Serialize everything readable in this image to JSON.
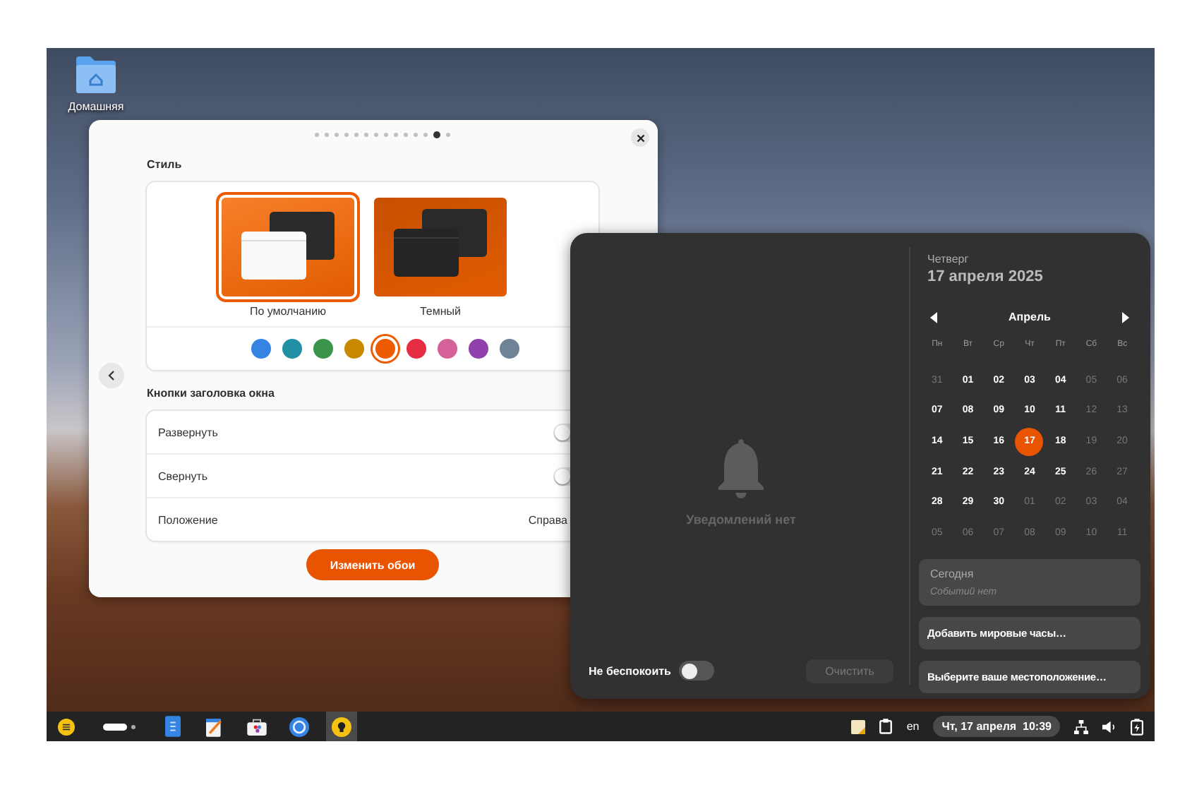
{
  "desktop_icons": [
    {
      "label": "Домашняя"
    }
  ],
  "settings_dialog": {
    "page_dots": [
      {
        "selected": false
      },
      {
        "selected": false
      },
      {
        "selected": false
      },
      {
        "selected": false
      },
      {
        "selected": false
      },
      {
        "selected": false
      },
      {
        "selected": false
      },
      {
        "selected": false
      },
      {
        "selected": false
      },
      {
        "selected": false
      },
      {
        "selected": false
      },
      {
        "selected": false
      },
      {
        "selected": true
      },
      {
        "selected": false
      }
    ],
    "style_section": {
      "title": "Стиль",
      "themes": [
        {
          "kind": "light",
          "label": "По умолчанию",
          "selected": true
        },
        {
          "kind": "dark",
          "label": "Темный",
          "selected": false
        }
      ],
      "accent_colors": [
        {
          "color": "#3584e4",
          "selected": false
        },
        {
          "color": "#2190a4",
          "selected": false
        },
        {
          "color": "#3a944a",
          "selected": false
        },
        {
          "color": "#c88800",
          "selected": false
        },
        {
          "color": "#ed5b00",
          "selected": true
        },
        {
          "color": "#e62d42",
          "selected": false
        },
        {
          "color": "#d56199",
          "selected": false
        },
        {
          "color": "#9141ac",
          "selected": false
        },
        {
          "color": "#6f8396",
          "selected": false
        }
      ]
    },
    "title_buttons_section": {
      "title": "Кнопки заголовка окна",
      "rows": [
        {
          "kind": "toggle",
          "label": "Развернуть",
          "on": false
        },
        {
          "kind": "toggle",
          "label": "Свернуть",
          "on": false
        },
        {
          "kind": "value",
          "label": "Положение",
          "value": "Справа"
        }
      ]
    },
    "primary_button": "Изменить обои"
  },
  "notifications": {
    "empty_text": "Уведомлений нет",
    "dnd_label": "Не беспокоить",
    "dnd_on": false,
    "clear_button": {
      "label": "Очистить",
      "disabled": true
    }
  },
  "calendar": {
    "weekday": "Четверг",
    "date": "17 апреля 2025",
    "month": "Апрель",
    "weekday_headers": [
      "Пн",
      "Вт",
      "Ср",
      "Чт",
      "Пт",
      "Сб",
      "Вс"
    ],
    "days": [
      {
        "label": "31",
        "dim": true,
        "selected": false
      },
      {
        "label": "01",
        "dim": false,
        "selected": false
      },
      {
        "label": "02",
        "dim": false,
        "selected": false
      },
      {
        "label": "03",
        "dim": false,
        "selected": false
      },
      {
        "label": "04",
        "dim": false,
        "selected": false
      },
      {
        "label": "05",
        "dim": true,
        "selected": false
      },
      {
        "label": "06",
        "dim": true,
        "selected": false
      },
      {
        "label": "07",
        "dim": false,
        "selected": false
      },
      {
        "label": "08",
        "dim": false,
        "selected": false
      },
      {
        "label": "09",
        "dim": false,
        "selected": false
      },
      {
        "label": "10",
        "dim": false,
        "selected": false
      },
      {
        "label": "11",
        "dim": false,
        "selected": false
      },
      {
        "label": "12",
        "dim": true,
        "selected": false
      },
      {
        "label": "13",
        "dim": true,
        "selected": false
      },
      {
        "label": "14",
        "dim": false,
        "selected": false
      },
      {
        "label": "15",
        "dim": false,
        "selected": false
      },
      {
        "label": "16",
        "dim": false,
        "selected": false
      },
      {
        "label": "17",
        "dim": false,
        "selected": true
      },
      {
        "label": "18",
        "dim": false,
        "selected": false
      },
      {
        "label": "19",
        "dim": true,
        "selected": false
      },
      {
        "label": "20",
        "dim": true,
        "selected": false
      },
      {
        "label": "21",
        "dim": false,
        "selected": false
      },
      {
        "label": "22",
        "dim": false,
        "selected": false
      },
      {
        "label": "23",
        "dim": false,
        "selected": false
      },
      {
        "label": "24",
        "dim": false,
        "selected": false
      },
      {
        "label": "25",
        "dim": false,
        "selected": false
      },
      {
        "label": "26",
        "dim": true,
        "selected": false
      },
      {
        "label": "27",
        "dim": true,
        "selected": false
      },
      {
        "label": "28",
        "dim": false,
        "selected": false
      },
      {
        "label": "29",
        "dim": false,
        "selected": false
      },
      {
        "label": "30",
        "dim": false,
        "selected": false
      },
      {
        "label": "01",
        "dim": true,
        "selected": false
      },
      {
        "label": "02",
        "dim": true,
        "selected": false
      },
      {
        "label": "03",
        "dim": true,
        "selected": false
      },
      {
        "label": "04",
        "dim": true,
        "selected": false
      },
      {
        "label": "05",
        "dim": true,
        "selected": false
      },
      {
        "label": "06",
        "dim": true,
        "selected": false
      },
      {
        "label": "07",
        "dim": true,
        "selected": false
      },
      {
        "label": "08",
        "dim": true,
        "selected": false
      },
      {
        "label": "09",
        "dim": true,
        "selected": false
      },
      {
        "label": "10",
        "dim": true,
        "selected": false
      },
      {
        "label": "11",
        "dim": true,
        "selected": false
      }
    ],
    "events": {
      "title": "Сегодня",
      "empty_text": "Событий нет"
    },
    "buttons": [
      "Добавить мировые часы…",
      "Выберите ваше местоположение…"
    ]
  },
  "taskbar": {
    "apps": [
      {
        "kind": "files",
        "selected": false
      },
      {
        "kind": "editor",
        "selected": false
      },
      {
        "kind": "store",
        "selected": false
      },
      {
        "kind": "browser",
        "selected": false
      },
      {
        "kind": "bulb",
        "selected": true
      }
    ],
    "keyboard_layout": "en",
    "clock": "Чт, 17 апреля  10:39"
  }
}
